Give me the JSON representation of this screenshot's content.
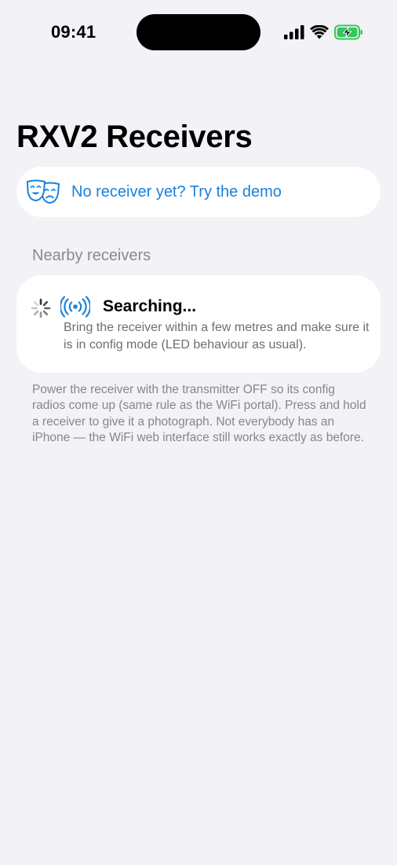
{
  "status_bar": {
    "time": "09:41",
    "icons": [
      "cellular-signal-icon",
      "wifi-icon",
      "battery-charging-icon"
    ],
    "battery_color": "#34C759"
  },
  "header": {
    "title": "RXV2 Receivers"
  },
  "demo_card": {
    "icon": "theater-masks-icon",
    "label": "No receiver yet?  Try the demo",
    "accent_color": "#1A82D9"
  },
  "nearby": {
    "section_title": "Nearby receivers",
    "status": {
      "spinner_icon": "activity-spinner-icon",
      "icon": "broadcast-radio-icon",
      "title": "Searching...",
      "description": "Bring the receiver within a few metres and make sure it is in config mode (LED behaviour as usual)."
    },
    "footer_note": "Power the receiver with the transmitter OFF so its config radios come up (same rule as the WiFi portal). Press and hold a receiver to give it a photograph. Not everybody has an iPhone — the WiFi web interface still works exactly as before."
  }
}
